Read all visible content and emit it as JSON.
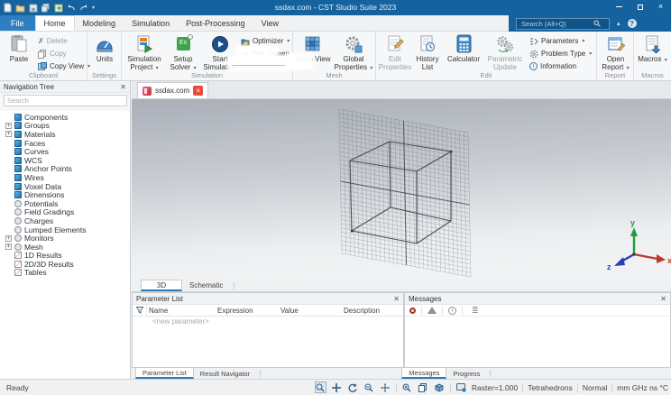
{
  "titlebar": {
    "title": "ssdax.com - CST Studio Suite 2023",
    "search_placeholder": "Search (Alt+Q)"
  },
  "menu": {
    "tabs": [
      {
        "label": "File"
      },
      {
        "label": "Home"
      },
      {
        "label": "Modeling"
      },
      {
        "label": "Simulation"
      },
      {
        "label": "Post-Processing"
      },
      {
        "label": "View"
      }
    ]
  },
  "ribbon": {
    "clipboard": {
      "label": "Clipboard",
      "paste": "Paste",
      "del": "Delete",
      "copy": "Copy",
      "copy_view": "Copy View"
    },
    "settings": {
      "label": "Settings",
      "units": "Units"
    },
    "simulation": {
      "label": "Simulation",
      "project": "Simulation Project",
      "solver": "Setup Solver",
      "start": "Start Simulation",
      "optimizer": "Optimizer",
      "par_sweep": "Par. Sweep"
    },
    "mesh": {
      "label": "Mesh",
      "mesh_view": "Mesh View",
      "global_properties": "Global Properties"
    },
    "edit": {
      "label": "Edit",
      "edit_properties": "Edit Properties",
      "history_list": "History List",
      "calculator": "Calculator",
      "parametric_update": "Parametric Update",
      "parameters": "Parameters",
      "problem_type": "Problem Type",
      "information": "Information"
    },
    "report": {
      "label": "Report",
      "open_report": "Open Report"
    },
    "macros": {
      "label": "Macros",
      "macros_btn": "Macros"
    }
  },
  "nav_tree": {
    "title": "Navigation Tree",
    "search_placeholder": "Search",
    "items": [
      {
        "label": "Components",
        "icon": "cube",
        "expandable": false
      },
      {
        "label": "Groups",
        "icon": "cube",
        "expandable": true
      },
      {
        "label": "Materials",
        "icon": "cube",
        "expandable": true
      },
      {
        "label": "Faces",
        "icon": "cube",
        "expandable": false
      },
      {
        "label": "Curves",
        "icon": "cube",
        "expandable": false
      },
      {
        "label": "WCS",
        "icon": "cube",
        "expandable": false
      },
      {
        "label": "Anchor Points",
        "icon": "cube",
        "expandable": false
      },
      {
        "label": "Wires",
        "icon": "cube",
        "expandable": false
      },
      {
        "label": "Voxel Data",
        "icon": "cube",
        "expandable": false
      },
      {
        "label": "Dimensions",
        "icon": "cube",
        "expandable": false
      },
      {
        "label": "Potentials",
        "icon": "circle",
        "expandable": false
      },
      {
        "label": "Field Gradings",
        "icon": "circle",
        "expandable": false
      },
      {
        "label": "Charges",
        "icon": "circle",
        "expandable": false
      },
      {
        "label": "Lumped Elements",
        "icon": "circle",
        "expandable": false
      },
      {
        "label": "Monitors",
        "icon": "circle",
        "expandable": true
      },
      {
        "label": "Mesh",
        "icon": "circle",
        "expandable": true
      },
      {
        "label": "1D Results",
        "icon": "chart",
        "expandable": false
      },
      {
        "label": "2D/3D Results",
        "icon": "chart",
        "expandable": false
      },
      {
        "label": "Tables",
        "icon": "chart",
        "expandable": false
      }
    ]
  },
  "document_tabs": {
    "active": "ssdax.com"
  },
  "view_tabs": [
    {
      "label": "3D"
    },
    {
      "label": "Schematic"
    }
  ],
  "parameter_list": {
    "title": "Parameter List",
    "columns": [
      "Name",
      "Expression",
      "Value",
      "Description"
    ],
    "new_row": "<new parameter>",
    "tabs": [
      "Parameter List",
      "Result Navigator"
    ]
  },
  "messages": {
    "title": "Messages",
    "tabs": [
      "Messages",
      "Progress"
    ]
  },
  "status_bar": {
    "ready": "Ready",
    "raster": "Raster=1.000",
    "mesh_type": "Tetrahedrons",
    "mode": "Normal",
    "units": "mm GHz ns °C"
  },
  "axes": {
    "x": "x",
    "y": "y",
    "z": "z"
  },
  "colors": {
    "titlebar_blue": "#15639e",
    "accent_blue": "#2a7ab8",
    "axis_x_red": "#c0392b",
    "axis_y_green": "#1f9e3e",
    "axis_z_blue": "#2a3bc0",
    "close_red": "#e74c3c"
  }
}
